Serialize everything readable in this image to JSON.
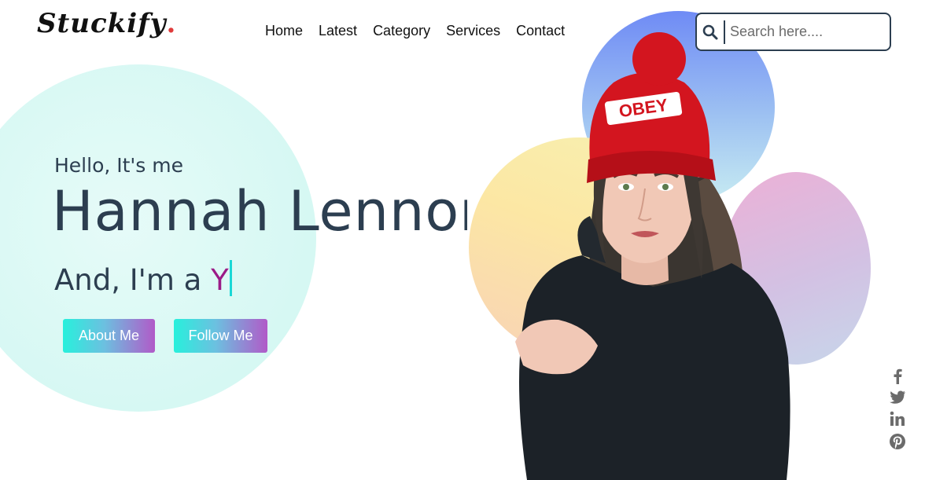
{
  "brand": {
    "logo_text": "Stuckify",
    "logo_dot": "."
  },
  "nav": {
    "items": [
      "Home",
      "Latest",
      "Category",
      "Services",
      "Contact"
    ]
  },
  "search": {
    "placeholder": "Search here....",
    "value": "",
    "icon": "search-icon"
  },
  "hero": {
    "greeting": "Hello, It's me",
    "name": "Hannah Lennon",
    "role_prefix": "And, I'm a",
    "role_typed": "Y",
    "buttons": {
      "about": "About Me",
      "follow": "Follow Me"
    }
  },
  "social": {
    "icons": [
      "facebook-icon",
      "twitter-icon",
      "linkedin-icon",
      "pinterest-icon"
    ]
  },
  "colors": {
    "text": "#2c3e50",
    "accent_typed": "#9b1b87",
    "cursor": "#1ad8d6",
    "button_from": "#27f0dc",
    "button_to": "#b15ac8"
  }
}
